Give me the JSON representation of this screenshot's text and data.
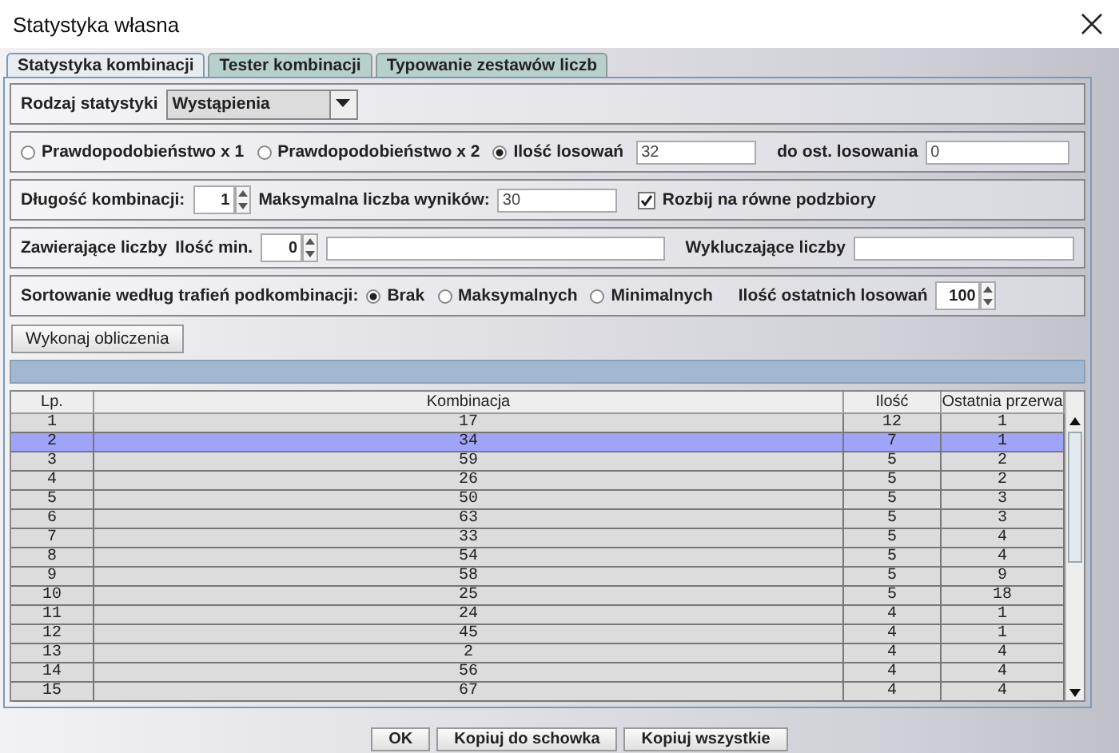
{
  "window": {
    "title": "Statystyka własna"
  },
  "tabs": [
    {
      "label": "Statystyka kombinacji",
      "selected": true
    },
    {
      "label": "Tester kombinacji",
      "selected": false
    },
    {
      "label": "Typowanie zestawów liczb",
      "selected": false
    }
  ],
  "statistic_type": {
    "label": "Rodzaj statystyki",
    "value": "Wystąpienia"
  },
  "mode_options": [
    {
      "label": "Prawdopodobieństwo x 1",
      "selected": false
    },
    {
      "label": "Prawdopodobieństwo x 2",
      "selected": false
    },
    {
      "label": "Ilość losowań",
      "selected": true
    }
  ],
  "draw_count": {
    "value": "32"
  },
  "until_last": {
    "label": "do ost. losowania",
    "value": "0"
  },
  "length": {
    "label": "Długość kombinacji:",
    "value": "1"
  },
  "max_results": {
    "label": "Maksymalna liczba wyników:",
    "value": "30"
  },
  "split": {
    "label": "Rozbij na równe podzbiory",
    "checked": true
  },
  "contains": {
    "label": "Zawierające liczby",
    "min_label": "Ilość min.",
    "min_value": "0"
  },
  "excludes": {
    "label": "Wykluczające liczby"
  },
  "sorting": {
    "label": "Sortowanie według trafień podkombinacji:",
    "options": [
      {
        "label": "Brak",
        "selected": true
      },
      {
        "label": "Maksymalnych",
        "selected": false
      },
      {
        "label": "Minimalnych",
        "selected": false
      }
    ],
    "recent_label": "Ilość ostatnich losowań",
    "recent_value": "100"
  },
  "compute_button": "Wykonaj obliczenia",
  "progress": {
    "level": 1
  },
  "table": {
    "columns": [
      "Lp.",
      "Kombinacja",
      "Ilość",
      "Ostatnia przerwa"
    ],
    "rows": [
      {
        "cells": [
          "1",
          "17",
          "12",
          "1"
        ],
        "selected": false
      },
      {
        "cells": [
          "2",
          "34",
          "7",
          "1"
        ],
        "selected": true
      },
      {
        "cells": [
          "3",
          "59",
          "5",
          "2"
        ],
        "selected": false
      },
      {
        "cells": [
          "4",
          "26",
          "5",
          "2"
        ],
        "selected": false
      },
      {
        "cells": [
          "5",
          "50",
          "5",
          "3"
        ],
        "selected": false
      },
      {
        "cells": [
          "6",
          "63",
          "5",
          "3"
        ],
        "selected": false
      },
      {
        "cells": [
          "7",
          "33",
          "5",
          "4"
        ],
        "selected": false
      },
      {
        "cells": [
          "8",
          "54",
          "5",
          "4"
        ],
        "selected": false
      },
      {
        "cells": [
          "9",
          "58",
          "5",
          "9"
        ],
        "selected": false
      },
      {
        "cells": [
          "10",
          "25",
          "5",
          "18"
        ],
        "selected": false
      },
      {
        "cells": [
          "11",
          "24",
          "4",
          "1"
        ],
        "selected": false
      },
      {
        "cells": [
          "12",
          "45",
          "4",
          "1"
        ],
        "selected": false
      },
      {
        "cells": [
          "13",
          "2",
          "4",
          "4"
        ],
        "selected": false
      },
      {
        "cells": [
          "14",
          "56",
          "4",
          "4"
        ],
        "selected": false
      },
      {
        "cells": [
          "15",
          "67",
          "4",
          "4"
        ],
        "selected": false
      }
    ]
  },
  "buttons": [
    "OK",
    "Kopiuj do schowka",
    "Kopiuj wszystkie"
  ]
}
